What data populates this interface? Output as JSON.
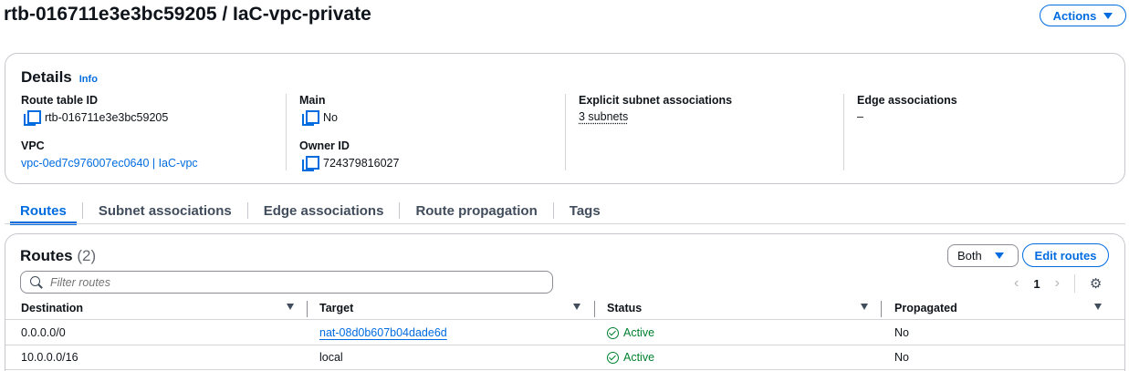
{
  "header": {
    "title": "rtb-016711e3e3bc59205 / IaC-vpc-private",
    "actions_label": "Actions"
  },
  "details": {
    "title": "Details",
    "info": "Info",
    "route_table_id_label": "Route table ID",
    "route_table_id": "rtb-016711e3e3bc59205",
    "main_label": "Main",
    "main_value": "No",
    "explicit_label": "Explicit subnet associations",
    "explicit_value": "3 subnets",
    "edge_label": "Edge associations",
    "edge_value": "–",
    "vpc_label": "VPC",
    "vpc_value": "vpc-0ed7c976007ec0640 | IaC-vpc",
    "owner_label": "Owner ID",
    "owner_value": "724379816027"
  },
  "tabs": [
    {
      "label": "Routes",
      "active": true
    },
    {
      "label": "Subnet associations"
    },
    {
      "label": "Edge associations"
    },
    {
      "label": "Route propagation"
    },
    {
      "label": "Tags"
    }
  ],
  "routes": {
    "title": "Routes",
    "count": "(2)",
    "filter_select": "Both",
    "edit_label": "Edit routes",
    "filter_placeholder": "Filter routes",
    "page": "1",
    "columns": [
      "Destination",
      "Target",
      "Status",
      "Propagated"
    ],
    "rows": [
      {
        "destination": "0.0.0.0/0",
        "target": "nat-08d0b607b04dade6d",
        "status": "Active",
        "propagated": "No"
      },
      {
        "destination": "10.0.0.0/16",
        "target": "local",
        "status": "Active",
        "propagated": "No"
      }
    ]
  },
  "colors": {
    "accent": "#006ce0",
    "success": "#00802f",
    "border": "#c6c6cd"
  }
}
